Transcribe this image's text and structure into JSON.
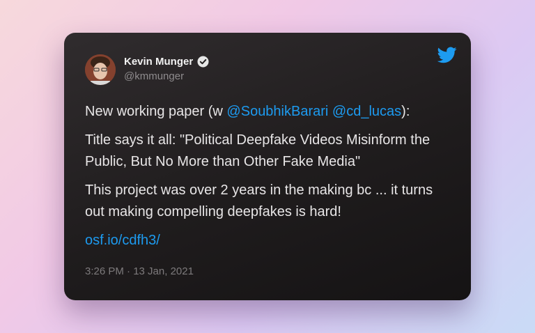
{
  "tweet": {
    "author_name": "Kevin Munger",
    "author_handle": "@kmmunger",
    "line1_prefix": "New working paper (w ",
    "mention1": "@SoubhikBarari",
    "space": " ",
    "mention2": "@cd_lucas",
    "line1_suffix": "):",
    "paragraph2": "Title says it all: \"Political Deepfake Videos Misinform the Public, But No More than Other Fake Media\"",
    "paragraph3": "This project was over 2 years in the making bc ... it turns out making compelling deepfakes is hard!",
    "link": "osf.io/cdfh3/",
    "timestamp": "3:26 PM · 13 Jan, 2021"
  },
  "colors": {
    "accent": "#1d9bf0",
    "card_bg": "#1f1c1d",
    "text": "#e8e6e7",
    "muted": "#8e8b8d"
  },
  "icons": {
    "brand": "twitter-bird-icon",
    "verified": "verified-badge-icon"
  }
}
